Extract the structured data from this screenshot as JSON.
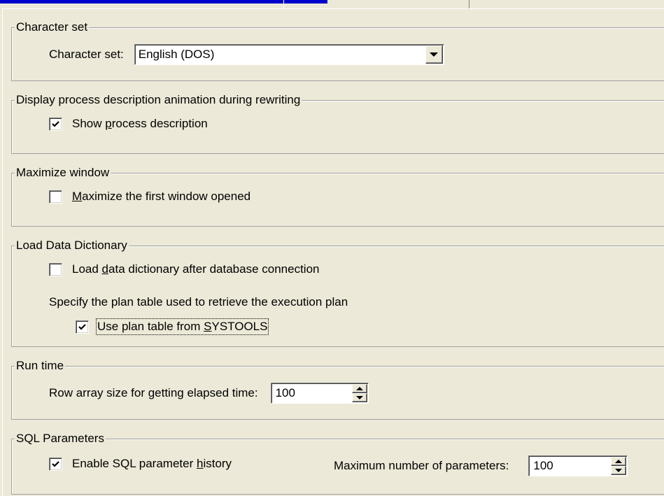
{
  "character_set": {
    "group_title": "Character set",
    "label": "Character set:",
    "selected": "English (DOS)"
  },
  "process_description": {
    "group_title": "Display process description animation during rewriting",
    "checkbox_label_pre": "Show ",
    "checkbox_label_mnemonic": "p",
    "checkbox_label_post": "rocess description",
    "checked": true
  },
  "maximize_window": {
    "group_title": "Maximize window",
    "checkbox_label_pre": "",
    "checkbox_label_mnemonic": "M",
    "checkbox_label_post": "aximize the first window opened",
    "checked": false
  },
  "load_data_dictionary": {
    "group_title": "Load Data Dictionary",
    "load_label_pre": "Load ",
    "load_label_mnemonic": "d",
    "load_label_post": "ata dictionary after database connection",
    "load_checked": false,
    "plan_table_text": "Specify the plan table used to retrieve the execution plan",
    "systools_label_pre": "Use plan table from ",
    "systools_label_mnemonic": "S",
    "systools_label_post": "YSTOOLS",
    "systools_checked": true
  },
  "run_time": {
    "group_title": "Run time",
    "label": "Row array size for getting elapsed time:",
    "value": "100"
  },
  "sql_parameters": {
    "group_title": "SQL Parameters",
    "history_label_pre": "Enable SQL parameter ",
    "history_label_mnemonic": "h",
    "history_label_post": "istory",
    "history_checked": true,
    "max_label": "Maximum number of parameters:",
    "max_value": "100"
  }
}
